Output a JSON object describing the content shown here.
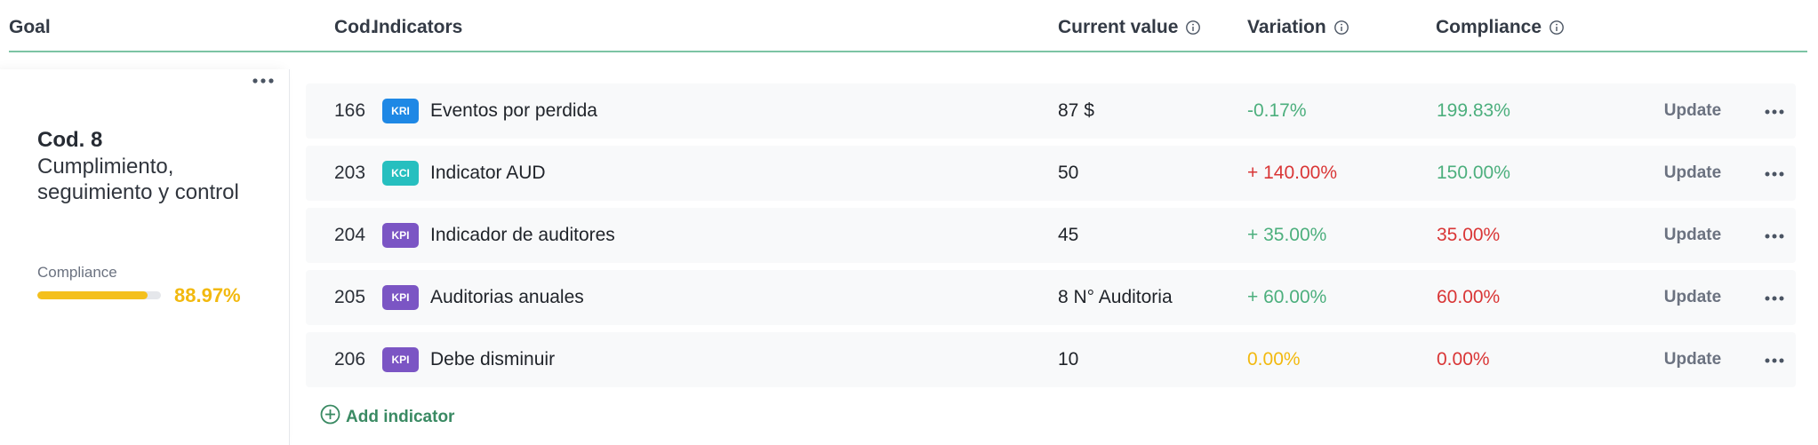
{
  "header": {
    "goal": "Goal",
    "cod": "Cod.",
    "indicators": "Indicators",
    "current_value": "Current value",
    "variation": "Variation",
    "compliance": "Compliance"
  },
  "goal": {
    "code": "Cod. 8",
    "name": "Cumplimiento, seguimiento y control",
    "compliance_label": "Compliance",
    "compliance_value": "88.97%",
    "compliance_fraction": 0.8897
  },
  "rows": [
    {
      "code": "166",
      "type": "KRI",
      "name": "Eventos por perdida",
      "current": "87 $",
      "variation": "-0.17%",
      "compliance": "199.83%",
      "action": "Update"
    },
    {
      "code": "203",
      "type": "KCI",
      "name": "Indicator AUD",
      "current": "50",
      "variation": "+ 140.00%",
      "compliance": "150.00%",
      "action": "Update"
    },
    {
      "code": "204",
      "type": "KPI",
      "name": "Indicador de auditores",
      "current": "45",
      "variation": "+ 35.00%",
      "compliance": "35.00%",
      "action": "Update"
    },
    {
      "code": "205",
      "type": "KPI",
      "name": "Auditorias anuales",
      "current": "8 N° Auditoria",
      "variation": "+ 60.00%",
      "compliance": "60.00%",
      "action": "Update"
    },
    {
      "code": "206",
      "type": "KPI",
      "name": "Debe disminuir",
      "current": "10",
      "variation": "0.00%",
      "compliance": "0.00%",
      "action": "Update"
    }
  ],
  "add_indicator": "Add indicator",
  "colors": {
    "green": "#4caf7d",
    "red": "#d93636",
    "yellow": "#f2b90f",
    "kri": "#1e88e5",
    "kci": "#26bfbf",
    "kpi": "#7b55c4",
    "accent_line": "#7cc4a4"
  }
}
